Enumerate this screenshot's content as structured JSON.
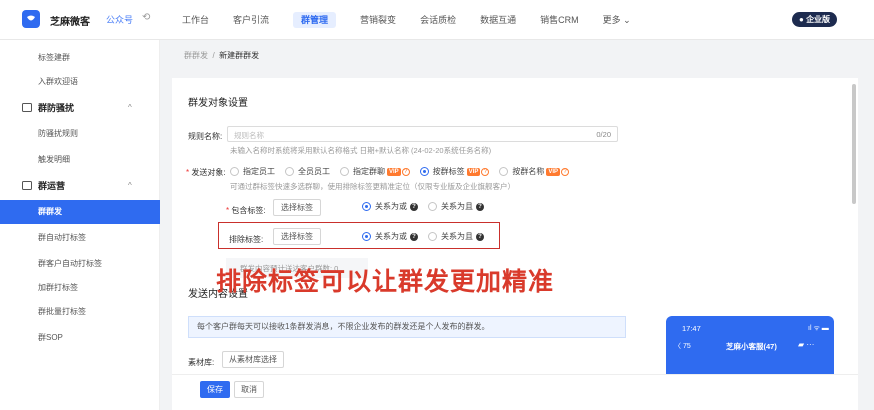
{
  "topbar": {
    "brand": "芝麻微客",
    "brand_sub": "公众号",
    "nav": [
      {
        "label": "工作台",
        "active": false
      },
      {
        "label": "客户引流",
        "active": false
      },
      {
        "label": "群管理",
        "active": true
      },
      {
        "label": "营销裂变",
        "active": false
      },
      {
        "label": "会话质检",
        "active": false
      },
      {
        "label": "数据互通",
        "active": false
      },
      {
        "label": "销售CRM",
        "active": false
      },
      {
        "label": "更多 ⌄",
        "active": false
      }
    ],
    "edition_badge": "企业版"
  },
  "sidebar": {
    "items": [
      {
        "label": "标签建群",
        "type": "item"
      },
      {
        "label": "入群欢迎语",
        "type": "item"
      },
      {
        "label": "群防骚扰",
        "type": "group",
        "icon": "shield-icon"
      },
      {
        "label": "防骚扰规则",
        "type": "item"
      },
      {
        "label": "触发明细",
        "type": "item"
      },
      {
        "label": "群运营",
        "type": "group",
        "icon": "chat-icon"
      },
      {
        "label": "群群发",
        "type": "item",
        "active": true
      },
      {
        "label": "群自动打标签",
        "type": "item"
      },
      {
        "label": "群客户自动打标签",
        "type": "item"
      },
      {
        "label": "加群打标签",
        "type": "item"
      },
      {
        "label": "群批量打标签",
        "type": "item"
      },
      {
        "label": "群SOP",
        "type": "item"
      }
    ]
  },
  "breadcrumb": {
    "parent": "群群发",
    "sep": "/",
    "current": "新建群群发"
  },
  "form": {
    "section_target": "群发对象设置",
    "rule_name_label": "规则名称:",
    "rule_name_placeholder": "规则名称",
    "rule_name_count": "0/20",
    "rule_name_hint": "未输入名称时系统将采用默认名称格式 日期+默认名称 (24-02-20系统任务名称)",
    "target_label": "发送对象:",
    "target_options": [
      {
        "label": "指定员工",
        "selected": false,
        "vip": false
      },
      {
        "label": "全员员工",
        "selected": false,
        "vip": false
      },
      {
        "label": "指定群聊",
        "selected": false,
        "vip": true
      },
      {
        "label": "按群标签",
        "selected": true,
        "vip": true
      },
      {
        "label": "按群名称",
        "selected": false,
        "vip": true
      }
    ],
    "vip_text": "VIP",
    "target_hint": "可通过群标签快速多选群聊，使用排除标签更精准定位（仅限专业版及企业旗舰客户）",
    "include_label": "包含标签:",
    "select_tag_btn": "选择标签",
    "relation_or": "关系为或",
    "relation_and": "关系为且",
    "exclude_label": "排除标签:",
    "estimate_text": "群发内容预计送达客户群数: 0",
    "section_content": "发送内容设置",
    "notice": "每个客户群每天可以接收1条群发消息，不限企业发布的群发还是个人发布的群发。",
    "material_label": "素材库:",
    "material_btn": "从素材库选择",
    "save": "保存",
    "cancel": "取消"
  },
  "overlay_caption": "排除标签可以让群发更加精准",
  "phone_preview": {
    "time": "17:47",
    "back": "75",
    "title": "芝麻小客服(47)"
  },
  "colors": {
    "accent": "#2f6bf0",
    "highlight": "#c9302c",
    "caption": "#d93a2b",
    "vip": "#ff7a2f"
  }
}
